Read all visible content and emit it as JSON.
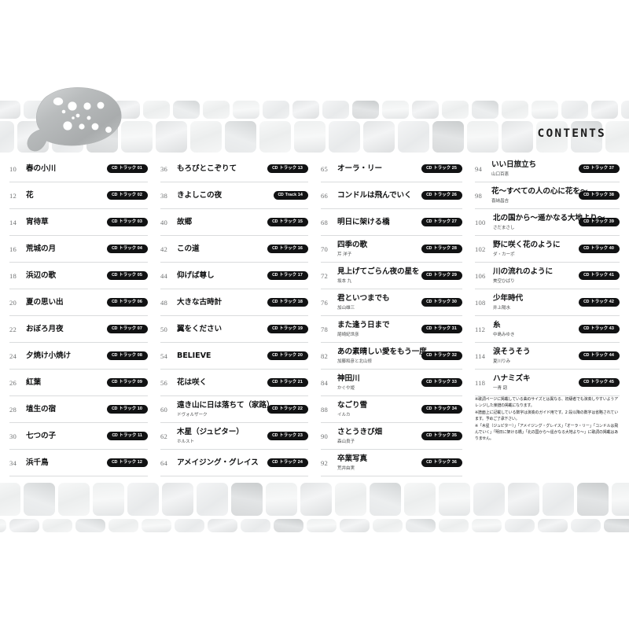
{
  "page": {
    "heading": "CONTENTS",
    "badge_cd_label": "CD",
    "illustration_name": "ocarina"
  },
  "columns": [
    {
      "id": "column-1",
      "entries": [
        {
          "page": "10",
          "title": "春の小川",
          "artist": "",
          "track": "トラック 01"
        },
        {
          "page": "12",
          "title": "花",
          "artist": "",
          "track": "トラック 02"
        },
        {
          "page": "14",
          "title": "宵待草",
          "artist": "",
          "track": "トラック 03"
        },
        {
          "page": "16",
          "title": "荒城の月",
          "artist": "",
          "track": "トラック 04"
        },
        {
          "page": "18",
          "title": "浜辺の歌",
          "artist": "",
          "track": "トラック 05"
        },
        {
          "page": "20",
          "title": "夏の思い出",
          "artist": "",
          "track": "トラック 06"
        },
        {
          "page": "22",
          "title": "おぼろ月夜",
          "artist": "",
          "track": "トラック 07"
        },
        {
          "page": "24",
          "title": "夕焼け小焼け",
          "artist": "",
          "track": "トラック 08"
        },
        {
          "page": "26",
          "title": "紅葉",
          "artist": "",
          "track": "トラック 09"
        },
        {
          "page": "28",
          "title": "埴生の宿",
          "artist": "",
          "track": "トラック 10"
        },
        {
          "page": "30",
          "title": "七つの子",
          "artist": "",
          "track": "トラック 11"
        },
        {
          "page": "34",
          "title": "浜千鳥",
          "artist": "",
          "track": "トラック 12"
        }
      ]
    },
    {
      "id": "column-2",
      "entries": [
        {
          "page": "36",
          "title": "もろびとこぞりて",
          "artist": "",
          "track": "トラック 13"
        },
        {
          "page": "38",
          "title": "きよしこの夜",
          "artist": "",
          "track": "Track 14"
        },
        {
          "page": "40",
          "title": "故郷",
          "artist": "",
          "track": "トラック 15"
        },
        {
          "page": "42",
          "title": "この道",
          "artist": "",
          "track": "トラック 16"
        },
        {
          "page": "44",
          "title": "仰げば尊し",
          "artist": "",
          "track": "トラック 17"
        },
        {
          "page": "48",
          "title": "大きな古時計",
          "artist": "",
          "track": "トラック 18"
        },
        {
          "page": "50",
          "title": "翼をください",
          "artist": "",
          "track": "トラック 19"
        },
        {
          "page": "54",
          "title": "BELIEVE",
          "artist": "",
          "track": "トラック 20"
        },
        {
          "page": "56",
          "title": "花は咲く",
          "artist": "",
          "track": "トラック 21"
        },
        {
          "page": "60",
          "title": "遠き山に日は落ちて（家路）",
          "artist": "ドヴォルザーク",
          "track": "トラック 22"
        },
        {
          "page": "62",
          "title": "木星（ジュピター）",
          "artist": "ホルスト",
          "track": "トラック 23"
        },
        {
          "page": "64",
          "title": "アメイジング・グレイス",
          "artist": "",
          "track": "トラック 24"
        }
      ]
    },
    {
      "id": "column-3",
      "entries": [
        {
          "page": "65",
          "title": "オーラ・リー",
          "artist": "",
          "track": "トラック 25"
        },
        {
          "page": "66",
          "title": "コンドルは飛んでいく",
          "artist": "",
          "track": "トラック 26"
        },
        {
          "page": "68",
          "title": "明日に架ける橋",
          "artist": "",
          "track": "トラック 27"
        },
        {
          "page": "70",
          "title": "四季の歌",
          "artist": "芹 洋子",
          "track": "トラック 28"
        },
        {
          "page": "72",
          "title": "見上げてごらん夜の星を",
          "artist": "坂本 九",
          "track": "トラック 29"
        },
        {
          "page": "76",
          "title": "君といつまでも",
          "artist": "加山雄三",
          "track": "トラック 30"
        },
        {
          "page": "78",
          "title": "また逢う日まで",
          "artist": "尾崎紀世彦",
          "track": "トラック 31"
        },
        {
          "page": "82",
          "title": "あの素晴しい愛をもう一度",
          "artist": "加藤和彦と北山修",
          "track": "トラック 32"
        },
        {
          "page": "84",
          "title": "神田川",
          "artist": "かぐや姫",
          "track": "トラック 33"
        },
        {
          "page": "88",
          "title": "なごり雪",
          "artist": "イルカ",
          "track": "トラック 34"
        },
        {
          "page": "90",
          "title": "さとうきび畑",
          "artist": "森山良子",
          "track": "トラック 35"
        },
        {
          "page": "92",
          "title": "卒業写真",
          "artist": "荒井由実",
          "track": "トラック 36"
        }
      ]
    },
    {
      "id": "column-4",
      "entries": [
        {
          "page": "94",
          "title": "いい日旅立ち",
          "artist": "山口百恵",
          "track": "トラック 37"
        },
        {
          "page": "98",
          "title": "花〜すべての人の心に花を〜",
          "artist": "喜納昌吉",
          "track": "トラック 38"
        },
        {
          "page": "100",
          "title": "北の国から〜遥かなる大地より〜",
          "artist": "さだまさし",
          "track": "トラック 39"
        },
        {
          "page": "102",
          "title": "野に咲く花のように",
          "artist": "ダ・カーポ",
          "track": "トラック 40"
        },
        {
          "page": "106",
          "title": "川の流れのように",
          "artist": "美空ひばり",
          "track": "トラック 41"
        },
        {
          "page": "108",
          "title": "少年時代",
          "artist": "井上陽水",
          "track": "トラック 42"
        },
        {
          "page": "112",
          "title": "糸",
          "artist": "中島みゆき",
          "track": "トラック 43"
        },
        {
          "page": "114",
          "title": "涙そうそう",
          "artist": "夏川りみ",
          "track": "トラック 44"
        },
        {
          "page": "118",
          "title": "ハナミズキ",
          "artist": "一青 窈",
          "track": "トラック 45"
        }
      ]
    }
  ],
  "footnotes": [
    "※歌詞ページに掲載している曲のサイズとは異なる、初級者でも演奏しやすいようアレンジした楽譜の掲載になります。",
    "※譜面上に記載している数字は演奏のガイド用です。2 段以降の数字は省略されています。予めご了承下さい。",
    "※「木星（ジュピター）」「アメイジング・グレイス」「オーラ・リー」「コンドルは飛んでいく」「明日に架ける橋」「北の国から〜遥かなる大地より〜」に歌詞の掲載はありません。"
  ]
}
